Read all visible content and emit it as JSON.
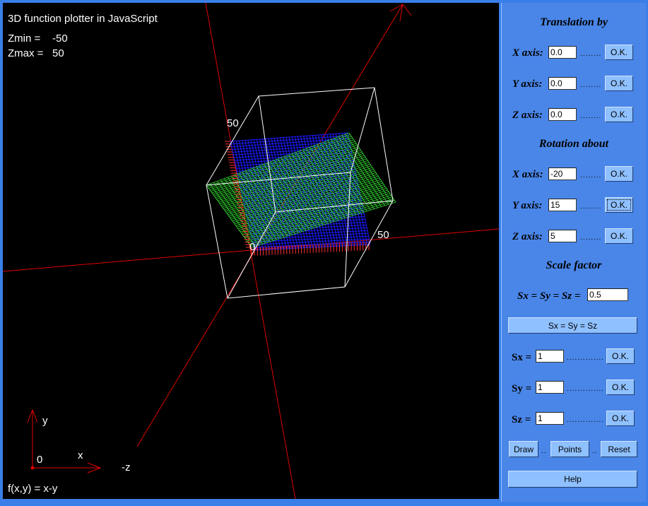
{
  "plot": {
    "title": "3D function plotter in JavaScript",
    "zmin_label": "Zmin =",
    "zmin_value": "-50",
    "zmax_label": "Zmax =",
    "zmax_value": "50",
    "tick_50_left": "50",
    "tick_50_right": "50",
    "tick_0": "0",
    "axis_y": "y",
    "axis_x": "x",
    "axis_origin": "0",
    "axis_neg_z": "-z",
    "function": "f(x,y) = x-y",
    "colors": {
      "background": "#000000",
      "axes": "#e00000",
      "box": "#ffffff",
      "surface_top": "#33dd33",
      "surface_under": "#1a1aff",
      "ticks": "#ff3030"
    }
  },
  "translation": {
    "title": "Translation by",
    "x_label": "X axis:",
    "x_value": "0.0",
    "y_label": "Y axis:",
    "y_value": "0.0",
    "z_label": "Z axis:",
    "z_value": "0.0",
    "dots": "........",
    "ok_label": "O.K."
  },
  "rotation": {
    "title": "Rotation about",
    "x_label": "X axis:",
    "x_value": "-20",
    "y_label": "Y axis:",
    "y_value": "15",
    "z_label": "Z axis:",
    "z_value": "5",
    "dots": "........",
    "ok_label": "O.K."
  },
  "scale": {
    "title": "Scale factor",
    "uniform_label": "Sx = Sy = Sz =",
    "uniform_value": "0.5",
    "uniform_button": "Sx = Sy = Sz",
    "sx_label": "Sx =",
    "sx_value": "1",
    "sy_label": "Sy =",
    "sy_value": "1",
    "sz_label": "Sz =",
    "sz_value": "1",
    "dots": "..............",
    "ok_label": "O.K."
  },
  "actions": {
    "draw": "Draw",
    "points": "Points",
    "reset": "Reset",
    "sep": "..",
    "help": "Help"
  },
  "panel_color": "#4a86e8"
}
